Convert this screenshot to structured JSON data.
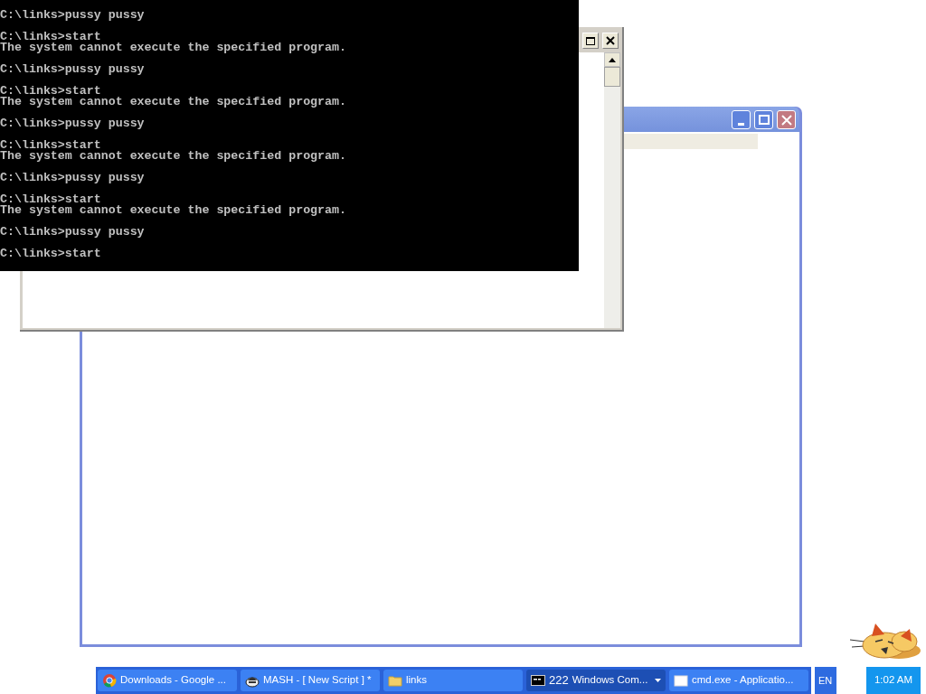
{
  "console": {
    "entries": [
      {
        "lines": [
          "C:\\links>pussy pussy"
        ]
      },
      {
        "lines": [
          "C:\\links>start",
          "The system cannot execute the specified program."
        ]
      },
      {
        "lines": [
          "C:\\links>pussy pussy"
        ]
      },
      {
        "lines": [
          "C:\\links>start",
          "The system cannot execute the specified program."
        ]
      },
      {
        "lines": [
          "C:\\links>pussy pussy"
        ]
      },
      {
        "lines": [
          "C:\\links>start",
          "The system cannot execute the specified program."
        ]
      },
      {
        "lines": [
          "C:\\links>pussy pussy"
        ]
      },
      {
        "lines": [
          "C:\\links>start",
          "The system cannot execute the specified program."
        ]
      },
      {
        "lines": [
          "C:\\links>pussy pussy"
        ]
      },
      {
        "lines": [
          "C:\\links>start"
        ]
      }
    ]
  },
  "taskbar": {
    "buttons": [
      {
        "kind": "browser",
        "label": "Downloads - Google ...",
        "selected": false
      },
      {
        "kind": "app",
        "label": "MASH - [ New Script ] *",
        "selected": false
      },
      {
        "kind": "folder",
        "label": "links",
        "selected": false
      },
      {
        "kind": "console",
        "count": "222",
        "label": "Windows Com...",
        "selected": true,
        "grouped": true
      },
      {
        "kind": "window",
        "label": "cmd.exe - Applicatio...",
        "selected": false
      }
    ],
    "language": "EN",
    "clock": "1:02 AM"
  }
}
